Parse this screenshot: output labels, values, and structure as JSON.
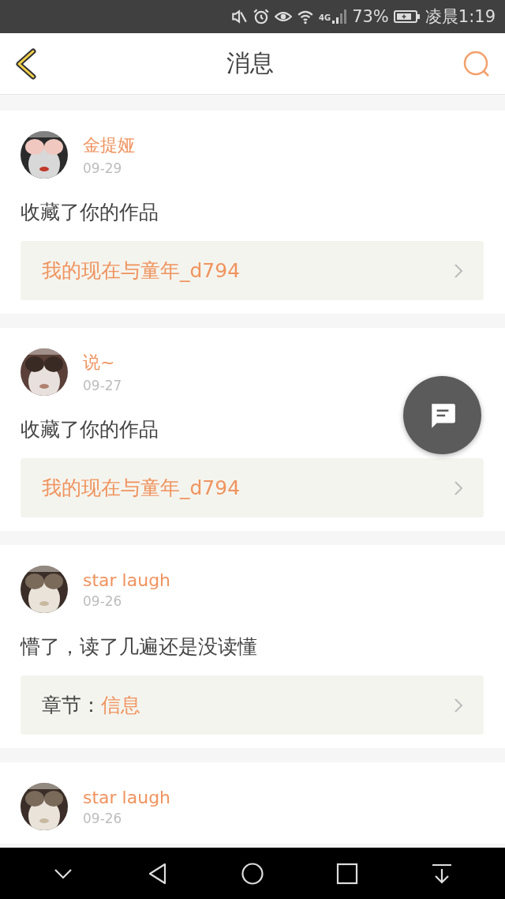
{
  "status_bar": {
    "network": "4G",
    "battery": "73%",
    "time": "凌晨1:19"
  },
  "header": {
    "title": "消息"
  },
  "messages": [
    {
      "user": "金提娅",
      "date": "09-29",
      "text": "收藏了你的作品",
      "attachment": {
        "kind": "work",
        "title": "我的现在与童年_d794"
      }
    },
    {
      "user": "说~",
      "date": "09-27",
      "text": "收藏了你的作品",
      "attachment": {
        "kind": "work",
        "title": "我的现在与童年_d794"
      }
    },
    {
      "user": "star laugh",
      "date": "09-26",
      "text": "懵了，读了几遍还是没读懂",
      "attachment": {
        "kind": "chapter",
        "label": "章节：",
        "title": "信息"
      }
    },
    {
      "user": "star laugh",
      "date": "09-26"
    }
  ]
}
